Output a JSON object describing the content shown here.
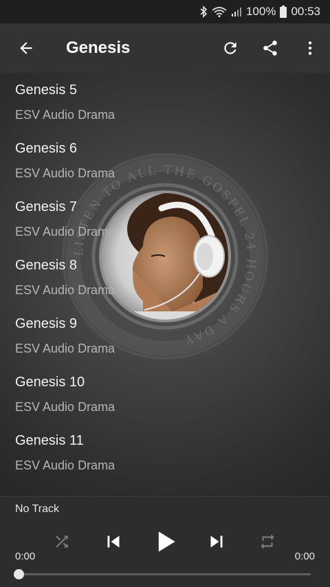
{
  "status": {
    "battery": "100%",
    "time": "00:53"
  },
  "appbar": {
    "title": "Genesis"
  },
  "list": [
    {
      "title": "Genesis 5",
      "subtitle": "ESV Audio Drama"
    },
    {
      "title": "Genesis 6",
      "subtitle": "ESV Audio Drama"
    },
    {
      "title": "Genesis 7",
      "subtitle": "ESV Audio Drama"
    },
    {
      "title": "Genesis 8",
      "subtitle": "ESV Audio Drama"
    },
    {
      "title": "Genesis 9",
      "subtitle": "ESV Audio Drama"
    },
    {
      "title": "Genesis 10",
      "subtitle": "ESV Audio Drama"
    },
    {
      "title": "Genesis 11",
      "subtitle": "ESV Audio Drama"
    }
  ],
  "emblem_text": "LISTEN TO ALL THE GOSPEL 24 HOURS A DAY",
  "player": {
    "track": "No Track",
    "elapsed": "0:00",
    "duration": "0:00",
    "progress": 0
  },
  "colors": {
    "appbar": "#333333",
    "statusbar": "#1f1f1f",
    "background": "#2b2b2b",
    "subtitle": "#b5b5b5"
  }
}
